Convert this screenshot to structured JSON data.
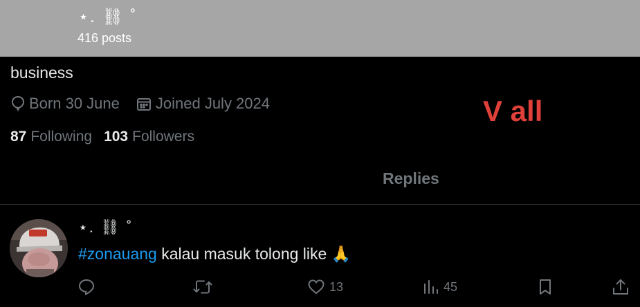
{
  "header": {
    "display_name": "⋆. ⛓ ˚",
    "posts_count": "416 posts"
  },
  "profile": {
    "bio": "business",
    "birthday": "Born 30 June",
    "joined": "Joined July 2024",
    "following_count": "87",
    "following_label": "Following",
    "followers_count": "103",
    "followers_label": "Followers"
  },
  "overlay": {
    "text": "V all",
    "color": "#e0403a"
  },
  "tabs": {
    "replies_label": "Replies"
  },
  "tweet": {
    "author": "⋆. ⛓ ˚",
    "hashtag": "#zonauang",
    "text": " kalau masuk tolong like ",
    "emoji": "🙏",
    "actions": {
      "reply_count": "",
      "repost_count": "",
      "like_count": "13",
      "views_count": "45"
    }
  },
  "colors": {
    "background": "#000000",
    "header_overlay": "#a6a6a6",
    "muted_text": "#71767b",
    "primary_text": "#e7e9ea",
    "link": "#1d9bf0"
  }
}
